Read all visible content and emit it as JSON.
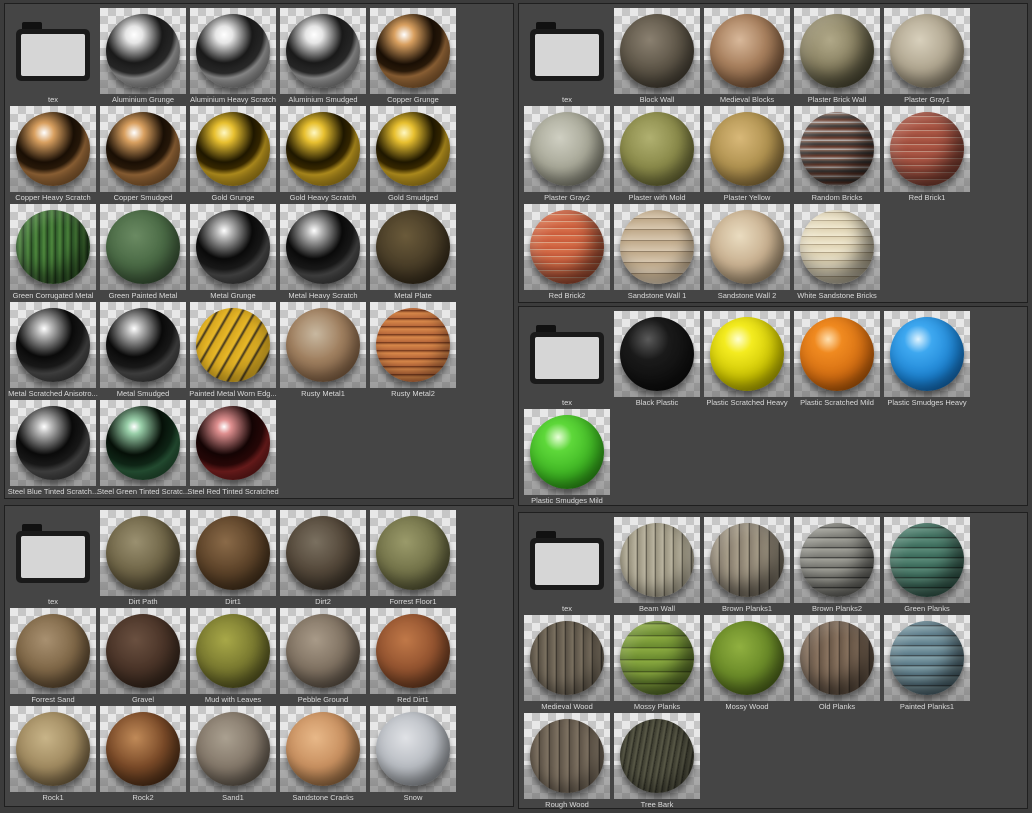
{
  "panels": [
    {
      "name": "metal",
      "folder_label": "tex",
      "materials": [
        {
          "label": "Aluminium Grunge",
          "style": "chrome"
        },
        {
          "label": "Aluminium Heavy Scratch",
          "style": "chrome"
        },
        {
          "label": "Aluminium Smudged",
          "style": "chrome"
        },
        {
          "label": "Copper Grunge",
          "style": "copper"
        },
        {
          "label": "Copper Heavy Scratch",
          "style": "copper"
        },
        {
          "label": "Copper Smudged",
          "style": "copper"
        },
        {
          "label": "Gold Grunge",
          "style": "gold"
        },
        {
          "label": "Gold Heavy Scratch",
          "style": "gold"
        },
        {
          "label": "Gold Smudged",
          "style": "gold"
        },
        {
          "label": "Green Corrugated Metal",
          "style": "greenstripe"
        },
        {
          "label": "Green Painted Metal",
          "style": "greenpaint"
        },
        {
          "label": "Metal Grunge",
          "style": "darkchrome"
        },
        {
          "label": "Metal Heavy Scratch",
          "style": "darkchrome"
        },
        {
          "label": "Metal Plate",
          "style": "plate"
        },
        {
          "label": "Metal Scratched Anisotro...",
          "style": "darkchrome"
        },
        {
          "label": "Metal Smudged",
          "style": "darkchrome"
        },
        {
          "label": "Painted Metal Worn Edg...",
          "style": "yellowworn"
        },
        {
          "label": "Rusty Metal1",
          "style": "rust1"
        },
        {
          "label": "Rusty Metal2",
          "style": "rust2"
        },
        {
          "label": "Steel Blue Tinted Scratch...",
          "style": "darkchrome"
        },
        {
          "label": "Steel Green Tinted Scratc...",
          "style": "greenchrome"
        },
        {
          "label": "Steel Red Tinted Scratched",
          "style": "redchrome"
        }
      ]
    },
    {
      "name": "walls",
      "folder_label": "tex",
      "materials": [
        {
          "label": "Block Wall",
          "style": "stone"
        },
        {
          "label": "Medieval Blocks",
          "style": "medieval"
        },
        {
          "label": "Plaster Brick Wall",
          "style": "plasterbrick"
        },
        {
          "label": "Plaster Gray1",
          "style": "plastergray"
        },
        {
          "label": "Plaster Gray2",
          "style": "plastergray2"
        },
        {
          "label": "Plaster with Mold",
          "style": "mold"
        },
        {
          "label": "Plaster Yellow",
          "style": "plasteryellow"
        },
        {
          "label": "Random Bricks",
          "style": "randombrick"
        },
        {
          "label": "Red Brick1",
          "style": "redbrick"
        },
        {
          "label": "Red Brick2",
          "style": "redbrick2"
        },
        {
          "label": "Sandstone Wall 1",
          "style": "sandstone"
        },
        {
          "label": "Sandstone Wall 2",
          "style": "sandstone2"
        },
        {
          "label": "White Sandstone Bricks",
          "style": "whitebrick"
        }
      ]
    },
    {
      "name": "plastic",
      "folder_label": "tex",
      "materials": [
        {
          "label": "Black Plastic",
          "style": "blackplastic"
        },
        {
          "label": "Plastic Scratched Heavy",
          "style": "yellowplastic"
        },
        {
          "label": "Plastic Scratched Mild",
          "style": "orangeplastic"
        },
        {
          "label": "Plastic Smudges Heavy",
          "style": "blueplastic"
        },
        {
          "label": "Plastic Smudges Mild",
          "style": "greenplastic"
        }
      ]
    },
    {
      "name": "ground",
      "folder_label": "tex",
      "materials": [
        {
          "label": "Dirt Path",
          "style": "dirtpath"
        },
        {
          "label": "Dirt1",
          "style": "dirt1"
        },
        {
          "label": "Dirt2",
          "style": "dirt2"
        },
        {
          "label": "Forrest Floor1",
          "style": "forest"
        },
        {
          "label": "Forrest Sand",
          "style": "sand"
        },
        {
          "label": "Gravel",
          "style": "gravel"
        },
        {
          "label": "Mud with Leaves",
          "style": "leaves"
        },
        {
          "label": "Pebble Ground",
          "style": "pebble"
        },
        {
          "label": "Red Dirt1",
          "style": "reddirt"
        },
        {
          "label": "Rock1",
          "style": "rock1"
        },
        {
          "label": "Rock2",
          "style": "rock2"
        },
        {
          "label": "Sand1",
          "style": "sand1"
        },
        {
          "label": "Sandstone Cracks",
          "style": "sandcrack"
        },
        {
          "label": "Snow",
          "style": "snow"
        }
      ]
    },
    {
      "name": "wood",
      "folder_label": "tex",
      "materials": [
        {
          "label": "Beam Wall",
          "style": "beam"
        },
        {
          "label": "Brown Planks1",
          "style": "brownplanks"
        },
        {
          "label": "Brown Planks2",
          "style": "grayplanks"
        },
        {
          "label": "Green Planks",
          "style": "greenplanks"
        },
        {
          "label": "Medieval Wood",
          "style": "medwood"
        },
        {
          "label": "Mossy Planks",
          "style": "mossyplanks"
        },
        {
          "label": "Mossy Wood",
          "style": "mossywood"
        },
        {
          "label": "Old Planks",
          "style": "oldplanks"
        },
        {
          "label": "Painted Planks1",
          "style": "paintedplanks"
        },
        {
          "label": "Rough Wood",
          "style": "roughwood"
        },
        {
          "label": "Tree Bark",
          "style": "bark"
        }
      ]
    }
  ],
  "styles": {
    "chrome": "radial-gradient(circle at 38% 28%, #ffffff 0%, #e6e6e6 12%, #1a1a1a 40%, #2b2b2b 55%, #9a9a9a 62%, #5a5a5a 100%)",
    "copper": "radial-gradient(circle at 38% 28%, #ffffff 0%, #d9a060 14%, #1a0f05 42%, #2a1a0a 52%, #9a6a3a 60%, #6a4520 100%)",
    "gold": "radial-gradient(circle at 38% 28%, #fff8c0 0%, #e8c030 14%, #201800 42%, #3a2a00 52%, #c09a20 60%, #8a6a10 100%)",
    "darkchrome": "radial-gradient(circle at 38% 28%, #ffffff 0%, #bbbbbb 10%, #0a0a0a 40%, #1a1a1a 55%, #4a4a4a 64%, #2a2a2a 100%)",
    "greenchrome": "radial-gradient(circle at 38% 28%, #ffffff 0%, #9ad0aa 10%, #061008 40%, #102818 55%, #2a5a3a 64%, #183a22 100%)",
    "redchrome": "radial-gradient(circle at 38% 28%, #ffffff 0%, #e09090 10%, #140404 40%, #2a0808 55%, #7a2020 64%, #4a1010 100%)",
    "greenstripe": "repeating-linear-gradient(90deg, #2e5a2a 0px, #4f8a3e 4px, #1e3a1a 8px), radial-gradient(circle, #3a6a30, #1a3018)",
    "greenpaint": "radial-gradient(circle at 40% 35%, #6a8a62 0%, #4a6a45 45%, #2a3e28 100%)",
    "plate": "radial-gradient(circle at 40% 35%, #6a5a3a 0%, #4a3e28 45%, #241c10 100%)",
    "yellowworn": "repeating-linear-gradient(120deg, #d8a820 0px, #e8b828 7px, #3a3020 9px, #d8a820 11px)",
    "rust1": "radial-gradient(circle at 40% 35%, #c8b8a0 0%, #a08060 40%, #6a4a30 100%)",
    "rust2": "repeating-linear-gradient(0deg, #b8683a 0px, #d8884a 5px, #6a3018 8px)",
    "stone": "radial-gradient(circle at 40% 35%, #8a8070 0%, #5e5648 45%, #2e2a22 100%)",
    "medieval": "radial-gradient(circle at 40% 35%, #d8b89a 0%, #a8805e 40%, #5a3a22 100%)",
    "plasterbrick": "radial-gradient(circle at 40% 35%, #b0a888 0%, #8a8262 45%, #4a4a30 100%)",
    "plastergray": "radial-gradient(circle at 40% 35%, #d8d0bc 0%, #b0a690 45%, #6a6250 100%)",
    "plastergray2": "radial-gradient(circle at 40% 35%, #cfcfc2 0%, #a8a898 45%, #5e5e52 100%)",
    "mold": "radial-gradient(circle at 40% 35%, #b0b070 0%, #8a8a4a 45%, #4a4a22 100%)",
    "plasteryellow": "radial-gradient(circle at 40% 35%, #d8b878 0%, #b09250 45%, #6a5228 100%)",
    "randombrick": "repeating-linear-gradient(0deg, #c0c0c0 0px, #6a3a2a 3px, #3a3a3a 6px, #8a6a5a 9px)",
    "redbrick": "repeating-linear-gradient(0deg, #9a4a3a 0px, #b05a48 6px, #d0c0b0 7px)",
    "redbrick2": "repeating-linear-gradient(0deg, #c85a3a 0px, #d8704a 6px, #e0d0b8 7px)",
    "sandstone": "repeating-linear-gradient(0deg, #d8c8b0 0px, #c0aa8a 10px, #6a5a48 11px)",
    "sandstone2": "radial-gradient(circle at 40% 35%, #eadcc0 0%, #c8b090 45%, #7a6a50 100%)",
    "whitebrick": "repeating-linear-gradient(0deg, #f0e8d0 0px, #e0d4b4 7px, #8a7a60 8px)",
    "blackplastic": "radial-gradient(circle at 38% 30%, #5a5a5a 0%, #1a1a1a 30%, #050505 100%)",
    "yellowplastic": "radial-gradient(circle at 38% 30%, #ffffd0 0%, #f4ec20 20%, #c8c000 60%, #8a8400 100%)",
    "orangeplastic": "radial-gradient(circle at 38% 30%, #ffe0b0 0%, #f08a20 20%, #d06a10 60%, #8a4000 100%)",
    "blueplastic": "radial-gradient(circle at 38% 30%, #e0f4ff 0%, #3ea8f0 20%, #1a80d0 60%, #0a4a8a 100%)",
    "greenplastic": "radial-gradient(circle at 38% 30%, #e8ffd8 0%, #5ed83a 20%, #3ab020 60%, #1a6a0a 100%)",
    "dirtpath": "radial-gradient(circle at 40% 35%, #9a9070 0%, #706648 45%, #3a3220 100%)",
    "dirt1": "radial-gradient(circle at 40% 35%, #8a6a48 0%, #5e442a 45%, #2e2010 100%)",
    "dirt2": "radial-gradient(circle at 40% 35%, #7a7060 0%, #54483a 45%, #2a241c 100%)",
    "forest": "radial-gradient(circle at 40% 35%, #9a9a6a 0%, #74744a 45%, #3a3a22 100%)",
    "sand": "radial-gradient(circle at 40% 35%, #a89070 0%, #806848 45%, #40301e 100%)",
    "gravel": "radial-gradient(circle at 40% 35%, #6a5040 0%, #4a3428 45%, #241a12 100%)",
    "leaves": "radial-gradient(circle at 40% 35%, #a8a848 0%, #7a7a30 45%, #3a3a14 100%)",
    "pebble": "radial-gradient(circle at 40% 35%, #a89a88 0%, #807262 45%, #403830 100%)",
    "reddirt": "radial-gradient(circle at 40% 35%, #c07848 0%, #945430 45%, #4a2814 100%)",
    "rock1": "radial-gradient(circle at 40% 35%, #c8b488 0%, #a08a60 45%, #504028 100%)",
    "rock2": "radial-gradient(circle at 40% 35%, #c08a58 0%, #7a4a28 45%, #2e1a0a 100%)",
    "sand1": "radial-gradient(circle at 40% 35%, #aaa090 0%, #84786a 45%, #423c34 100%)",
    "sandcrack": "radial-gradient(circle at 40% 35%, #e8b888 0%, #c89060 45%, #6a4a28 100%)",
    "snow": "radial-gradient(circle at 40% 35%, #e0e2e6 0%, #b8bcc2 45%, #707478 100%)",
    "beam": "repeating-linear-gradient(90deg, #9a9480 0px, #bab4a0 7px, #4a463a 9px)",
    "brownplanks": "repeating-linear-gradient(90deg, #8a8070 0px, #a89e8a 8px, #3a362e 10px)",
    "grayplanks": "repeating-linear-gradient(0deg, #7a7a74 0px, #a0a098 8px, #2a2a28 10px)",
    "greenplanks": "repeating-linear-gradient(0deg, #3a6a5a 0px, #5a8a78 8px, #1a2a24 10px)",
    "medwood": "repeating-linear-gradient(90deg, #5a5246 0px, #7a7060 7px, #2a2620 9px)",
    "mossyplanks": "repeating-linear-gradient(0deg, #6a8a30 0px, #8aaa40 10px, #3a4a18 12px)",
    "mossywood": "radial-gradient(circle at 40% 35%, #90b040 0%, #6a8a28 45%, #344410 100%)",
    "oldplanks": "repeating-linear-gradient(90deg, #6a5848 0px, #8a7460 8px, #3a3028 10px)",
    "paintedplanks": "repeating-linear-gradient(0deg, #5a7a88 0px, #84a2aa 8px, #2a3438 10px)",
    "roughwood": "repeating-linear-gradient(90deg, #5e5448 0px, #7e7262 8px, #2e2822 10px)",
    "bark": "repeating-linear-gradient(100deg, #3a3a2e 0px, #5a5a48 4px, #22221a 6px)"
  }
}
